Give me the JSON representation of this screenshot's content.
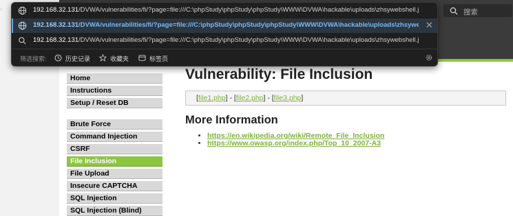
{
  "browser": {
    "search_placeholder": "搜索",
    "address_url": {
      "host": "192.168.32.131",
      "path": "/DVWA/vulnerabilities/fi/?page=file:///C:\\phpStudy\\phpStudy\\phpStudy\\WWW\\DVWA\\hackable\\uploads\\zhsywebshell.jpg"
    },
    "suggestions": [
      {
        "host": "192.168.32.131",
        "path": "/DVWA/vulnerabilities/fi/?page=file:///C:\\phpStudy\\phpStudy\\phpStudy\\WWW\\DVWA\\hackable\\uploads\\zhsywe..."
      },
      {
        "host": "192.168.32.131",
        "path": "/DVWA/vulnerabilities/fi/?page=file:///C:\\phpStudy\\phpStudy\\phpStudy\\WWW\\DVWA\\hackable\\uploads\\zhsywebshell.jpg"
      }
    ],
    "shortcuts": {
      "label": "筛选搜索:",
      "history": "历史记录",
      "favorites": "收藏夹",
      "tabs": "标签页"
    },
    "accent_color": "#6fa4d8"
  },
  "dvwa": {
    "menu": {
      "group1": [
        "Home",
        "Instructions",
        "Setup / Reset DB"
      ],
      "group2": [
        "Brute Force",
        "Command Injection",
        "CSRF",
        "File Inclusion",
        "File Upload",
        "Insecure CAPTCHA",
        "SQL Injection",
        "SQL Injection (Blind)"
      ],
      "selected": "File Inclusion"
    },
    "title": "Vulnerability: File Inclusion",
    "files": {
      "open": "[",
      "file1": "file1.php",
      "sep1": "] - [",
      "file2": "file2.php",
      "sep2": "] - [",
      "file3": "file3.php",
      "close": "]"
    },
    "more_info_title": "More Information",
    "links": [
      "https://en.wikipedia.org/wiki/Remote_File_Inclusion",
      "https://www.owasp.org/index.php/Top_10_2007-A3"
    ],
    "accent_color": "#8cc63f"
  }
}
